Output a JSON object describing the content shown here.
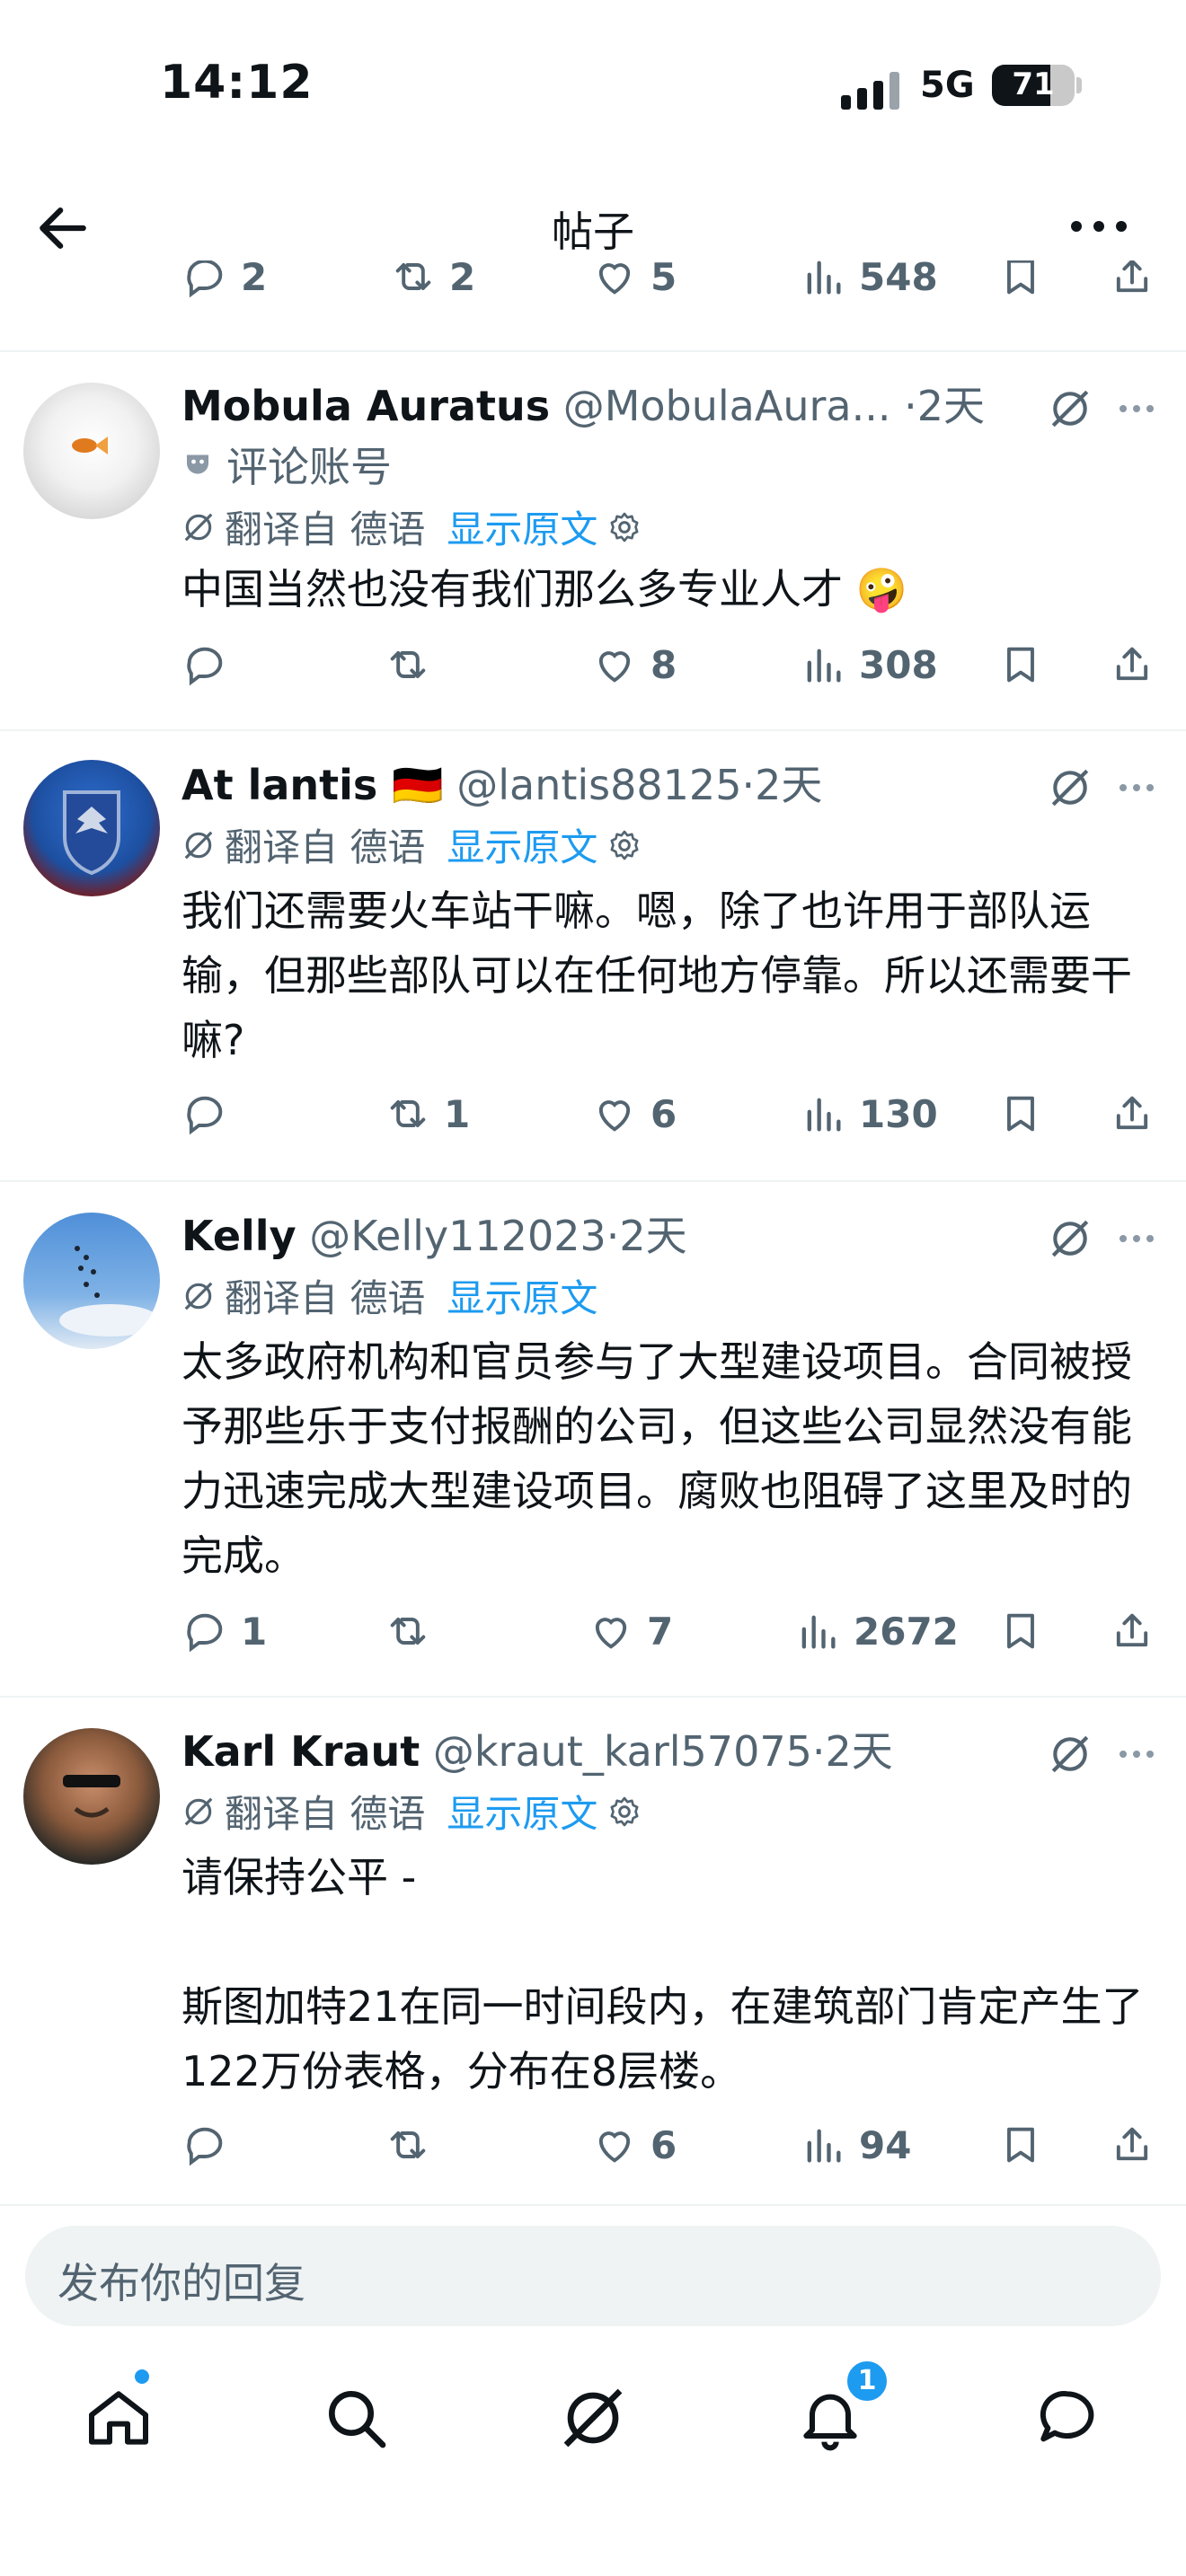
{
  "status_bar": {
    "time": "14:12",
    "network": "5G",
    "battery": "71",
    "battery_level": 0.71
  },
  "nav": {
    "title": "帖子",
    "back_icon": "arrow-left-icon",
    "more_icon": "more-horizontal-icon"
  },
  "top_partial_actions": {
    "replies": "2",
    "retweets": "2",
    "likes": "5",
    "views": "548"
  },
  "tweets": [
    {
      "name": "Mobula Auratus",
      "handle": "@MobulaAura...",
      "dot": "·",
      "time": "2天",
      "label": "评论账号",
      "translated_from": "翻译自 德语",
      "show_original": "显示原文",
      "text": "中国当然也没有我们那么多专业人才 🤪",
      "replies": "",
      "retweets": "",
      "likes": "8",
      "views": "308"
    },
    {
      "name": "At lantis 🇩🇪",
      "handle": "@lantis88125",
      "dot": "·",
      "time": "2天",
      "translated_from": "翻译自 德语",
      "show_original": "显示原文",
      "text": "我们还需要火车站干嘛。嗯，除了也许用于部队运输，但那些部队可以在任何地方停靠。所以还需要干嘛?",
      "replies": "",
      "retweets": "1",
      "likes": "6",
      "views": "130"
    },
    {
      "name": "Kelly",
      "handle": "@Kelly112023",
      "dot": "·",
      "time": "2天",
      "translated_from": "翻译自 德语",
      "show_original": "显示原文",
      "text": "太多政府机构和官员参与了大型建设项目。合同被授予那些乐于支付报酬的公司，但这些公司显然没有能力迅速完成大型建设项目。腐败也阻碍了这里及时的完成。",
      "replies": "1",
      "retweets": "",
      "likes": "7",
      "views": "2672"
    },
    {
      "name": "Karl Kraut",
      "handle": "@kraut_karl57075",
      "dot": "·",
      "time": "2天",
      "translated_from": "翻译自 德语",
      "show_original": "显示原文",
      "text_line1": "请保持公平 -",
      "text_line2": "斯图加特21在同一时间段内，在建筑部门肯定产生了122万份表格，分布在8层楼。",
      "replies": "",
      "retweets": "",
      "likes": "6",
      "views": "94"
    }
  ],
  "reply_box": {
    "placeholder": "发布你的回复"
  },
  "tabbar": {
    "notifications_badge": "1"
  },
  "colors": {
    "accent": "#1d9bf0",
    "muted": "#536471",
    "text": "#0f1419",
    "divider": "#eff3f4"
  }
}
